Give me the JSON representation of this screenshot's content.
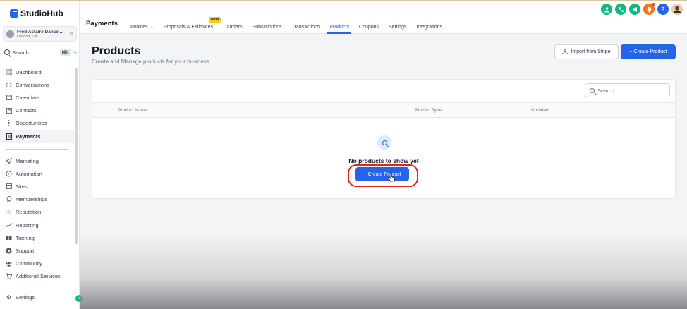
{
  "brand": {
    "name": "StudioHub"
  },
  "account": {
    "name": "Fred Astaire Dance ...",
    "location": "London, ON"
  },
  "search": {
    "label": "Search",
    "shortcut": "⌘K"
  },
  "sidebar": {
    "items": [
      {
        "label": "Dashboard",
        "icon": "grid-icon"
      },
      {
        "label": "Conversations",
        "icon": "chat-icon"
      },
      {
        "label": "Calendars",
        "icon": "calendar-icon"
      },
      {
        "label": "Contacts",
        "icon": "contacts-icon"
      },
      {
        "label": "Opportunities",
        "icon": "opportunities-icon"
      },
      {
        "label": "Payments",
        "icon": "payments-icon",
        "active": true
      }
    ],
    "items2": [
      {
        "label": "Marketing",
        "icon": "send-icon"
      },
      {
        "label": "Automation",
        "icon": "automation-icon"
      },
      {
        "label": "Sites",
        "icon": "sites-icon"
      },
      {
        "label": "Memberships",
        "icon": "memberships-icon"
      },
      {
        "label": "Reputation",
        "icon": "star-icon"
      },
      {
        "label": "Reporting",
        "icon": "trend-icon"
      },
      {
        "label": "Training",
        "icon": "book-icon"
      },
      {
        "label": "Support",
        "icon": "support-icon"
      },
      {
        "label": "Community",
        "icon": "community-icon"
      },
      {
        "label": "Additional Services",
        "icon": "cart-icon"
      }
    ],
    "settings": "Settings"
  },
  "topbar": {
    "title": "Payments",
    "tabs": [
      {
        "label": "Invoices",
        "dropdown": true
      },
      {
        "label": "Proposals & Estimates",
        "badge": "New"
      },
      {
        "label": "Orders"
      },
      {
        "label": "Subscriptions"
      },
      {
        "label": "Transactions"
      },
      {
        "label": "Products",
        "active": true
      },
      {
        "label": "Coupons"
      },
      {
        "label": "Settings"
      },
      {
        "label": "Integrations"
      }
    ],
    "icon_colors": [
      "#10b981",
      "#10b981",
      "#10b981",
      "#f97316",
      "#2563eb"
    ]
  },
  "page": {
    "title": "Products",
    "subtitle": "Create and Manage products for your business",
    "import_label": "Import from Stripe",
    "create_label": "+ Create Product"
  },
  "table": {
    "search_placeholder": "Search",
    "columns": [
      "Product Name",
      "Product Type",
      "Updated"
    ],
    "empty_text": "No products to show yet",
    "empty_button": "+ Create Product"
  },
  "colors": {
    "accent": "#2563eb",
    "highlight": "#dc2626",
    "success": "#10b981"
  }
}
